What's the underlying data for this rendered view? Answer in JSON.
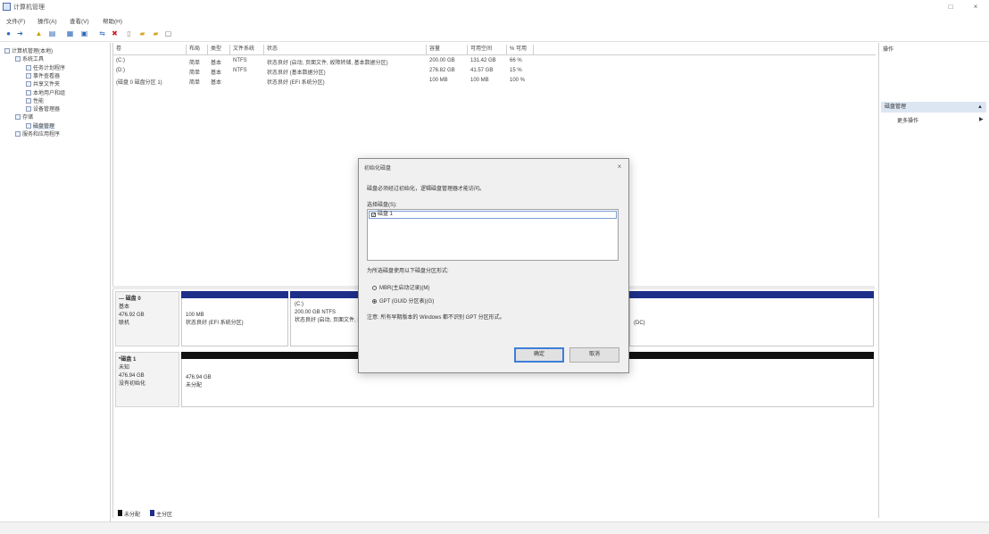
{
  "window": {
    "title": "计算机管理",
    "min": "□",
    "close": "×"
  },
  "menu": [
    "文件(F)",
    "操作(A)",
    "查看(V)",
    "帮助(H)"
  ],
  "toolbar": {
    "icons": [
      "back-icon",
      "forward-icon",
      "up-icon",
      "show-hide-tree-icon",
      "properties-icon",
      "help-icon",
      "connect-icon",
      "delete-icon",
      "open-icon",
      "folder-icon",
      "folder-search-icon",
      "export-icon"
    ],
    "glyphs": [
      "●",
      "➔",
      "▲",
      "▤",
      "▦",
      "▣",
      "⇋",
      "✖",
      "▯",
      "▰",
      "▰",
      "▢"
    ]
  },
  "tree": [
    {
      "label": "计算机管理(本地)",
      "indent": 0,
      "selected": false
    },
    {
      "label": "系统工具",
      "indent": 1,
      "selected": false
    },
    {
      "label": "任务计划程序",
      "indent": 2,
      "selected": false
    },
    {
      "label": "事件查看器",
      "indent": 2,
      "selected": false
    },
    {
      "label": "共享文件夹",
      "indent": 2,
      "selected": false
    },
    {
      "label": "本地用户和组",
      "indent": 2,
      "selected": false
    },
    {
      "label": "性能",
      "indent": 2,
      "selected": false
    },
    {
      "label": "设备管理器",
      "indent": 2,
      "selected": false
    },
    {
      "label": "存储",
      "indent": 1,
      "selected": false
    },
    {
      "label": "磁盘管理",
      "indent": 2,
      "selected": true
    },
    {
      "label": "服务和应用程序",
      "indent": 1,
      "selected": false
    }
  ],
  "volume_list": {
    "columns": [
      "卷",
      "布局",
      "类型",
      "文件系统",
      "状态",
      "容量",
      "可用空间",
      "% 可用"
    ],
    "rows": [
      [
        "(C:)",
        "简单",
        "基本",
        "NTFS",
        "状态良好 (启动, 页面文件, 故障转储, 基本数据分区)",
        "200.00 GB",
        "131.42 GB",
        "66 %"
      ],
      [
        "(D:)",
        "简单",
        "基本",
        "NTFS",
        "状态良好 (基本数据分区)",
        "276.82 GB",
        "41.57 GB",
        "15 %"
      ],
      [
        "(磁盘 0 磁盘分区 1)",
        "简单",
        "基本",
        "",
        "状态良好 (EFI 系统分区)",
        "100 MB",
        "100 MB",
        "100 %"
      ]
    ]
  },
  "disks": [
    {
      "name": "磁盘 0",
      "type": "基本",
      "size": "476.92 GB",
      "status": "联机",
      "partitions": [
        {
          "size": "100 MB",
          "status": "状态良好 (EFI 系统分区)"
        },
        {
          "name": "(C:)",
          "size": "200.00 GB NTFS",
          "status": "状态良好 (启动, 页面文件, 故障"
        },
        {
          "status": "(DC)"
        }
      ]
    },
    {
      "name": "磁盘 1",
      "type": "未知",
      "size": "476.94 GB",
      "status": "没有初始化",
      "partitions": [
        {
          "size": "476.94 GB",
          "status": "未分配"
        }
      ]
    }
  ],
  "legend": [
    {
      "label": "未分配",
      "color": "#111111"
    },
    {
      "label": "主分区",
      "color": "#1e2f8a"
    }
  ],
  "actions": {
    "header": "操作",
    "section": "磁盘管理",
    "more": "更多操作",
    "arrow": "▲",
    "more_arrow": "▶"
  },
  "dialog": {
    "title": "初始化磁盘",
    "close": "×",
    "instruction": "磁盘必须经过初始化，逻辑磁盘管理器才能访问。",
    "select_label": "选择磁盘(S):",
    "disk_item": "磁盘 1",
    "check": "✓",
    "style_label": "为所选磁盘使用以下磁盘分区形式:",
    "options": [
      {
        "label": "MBR(主启动记录)(M)",
        "selected": false
      },
      {
        "label": "GPT (GUID 分区表)(G)",
        "selected": true
      }
    ],
    "note": "注意: 所有早期版本的 Windows 都不识别 GPT 分区形式。",
    "ok": "确定",
    "cancel": "取消"
  }
}
